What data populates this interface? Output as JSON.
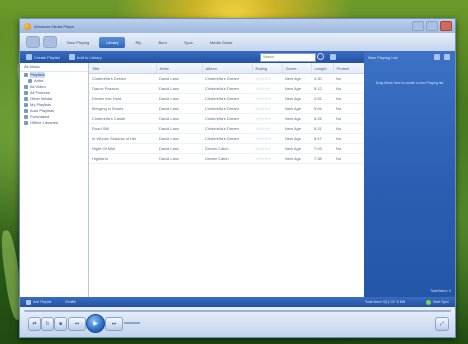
{
  "window": {
    "title": "Windows Media Player"
  },
  "tabs": {
    "items": [
      "Now Playing",
      "Library",
      "Rip",
      "Burn",
      "Sync",
      "Media Guide"
    ],
    "active_index": 1
  },
  "cmdbar": {
    "create_playlist": "Create Playlist",
    "add_to_library": "Add to Library",
    "search_placeholder": "Search"
  },
  "nav": {
    "header": "All Music",
    "items": [
      {
        "label": "Playlists",
        "selected": true,
        "sub": false
      },
      {
        "label": "Artist",
        "selected": false,
        "sub": true
      },
      {
        "label": "All Video",
        "selected": false,
        "sub": false
      },
      {
        "label": "All Pictures",
        "selected": false,
        "sub": false
      },
      {
        "label": "Other Media",
        "selected": false,
        "sub": false
      },
      {
        "label": "My Playlists",
        "selected": false,
        "sub": false
      },
      {
        "label": "Auto Playlists",
        "selected": false,
        "sub": false
      },
      {
        "label": "Purchased",
        "selected": false,
        "sub": false
      },
      {
        "label": "Offline Libraries",
        "selected": false,
        "sub": false
      }
    ]
  },
  "list": {
    "columns": [
      "Title",
      "Artist",
      "Album",
      "Rating",
      "Genre",
      "Length",
      "Protect"
    ],
    "rows": [
      [
        "Cinderella's Dream",
        "David Lanz",
        "Cinderella's Dream",
        "☆☆☆☆☆",
        "New Age",
        "4:30",
        "No"
      ],
      [
        "Dance Passion",
        "David Lanz",
        "Cinderella's Dream",
        "☆☆☆☆☆",
        "New Age",
        "5:12",
        "No"
      ],
      [
        "Dream Into Hold",
        "David Lanz",
        "Cinderella's Dream",
        "☆☆☆☆☆",
        "New Age",
        "4:52",
        "No"
      ],
      [
        "Bringing in Roses",
        "David Lanz",
        "Cinderella's Dream",
        "☆☆☆☆☆",
        "New Age",
        "5:04",
        "No"
      ],
      [
        "Cinderella's Castle",
        "David Lanz",
        "Cinderella's Dream",
        "☆☆☆☆☆",
        "New Age",
        "6:25",
        "No"
      ],
      [
        "Road Still",
        "David Lanz",
        "Cinderella's Dream",
        "☆☆☆☆☆",
        "New Age",
        "5:31",
        "No"
      ],
      [
        "In Whose Shadow of Her",
        "David Lanz",
        "Cinderella's Dream",
        "☆☆☆☆☆",
        "New Age",
        "6:47",
        "No"
      ],
      [
        "Night Of Mist",
        "David Lanz",
        "Dream Catch",
        "☆☆☆☆☆",
        "New Age",
        "7:03",
        "No"
      ],
      [
        "Highland",
        "David Lanz",
        "Dream Catch",
        "☆☆☆☆☆",
        "New Age",
        "7:38",
        "No"
      ]
    ]
  },
  "now_playing": {
    "header": "New Playing List",
    "message": "Drag items here to create a new Playing list.",
    "footer": "Total Items: 0"
  },
  "statusbar": {
    "left": "Add Playlist",
    "mid": "Shuffle",
    "right": "Total Items 9(1) 107.5 MB",
    "right2": "Start Sync"
  },
  "player": {
    "buttons": [
      "shuffle",
      "repeat",
      "stop",
      "previous",
      "play",
      "next",
      "mute"
    ]
  },
  "colors": {
    "accent": "#2f67b9",
    "pane_blue": "#2a5cb0",
    "chrome_light": "#d7e2f2"
  }
}
